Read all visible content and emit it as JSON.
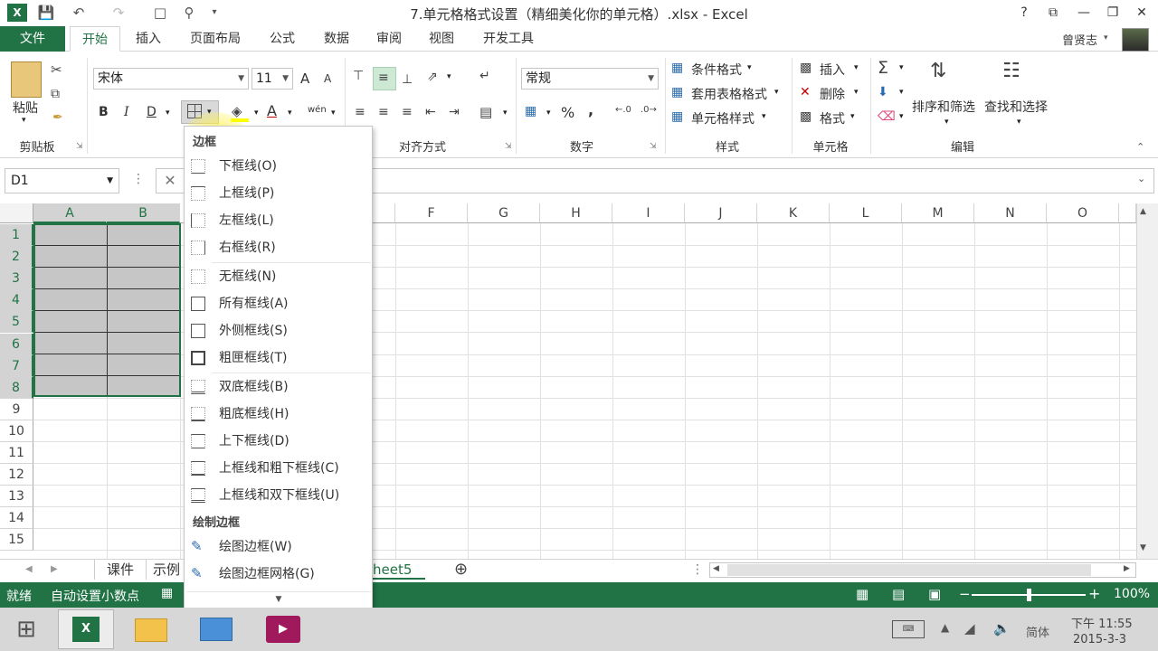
{
  "window": {
    "title": "7.单元格格式设置（精细美化你的单元格）.xlsx - Excel",
    "help": "?",
    "controls": [
      "⧉",
      "—",
      "❐",
      "✕"
    ]
  },
  "ribbon_tabs": {
    "file": "文件",
    "tabs": [
      "开始",
      "插入",
      "页面布局",
      "公式",
      "数据",
      "审阅",
      "视图",
      "开发工具"
    ],
    "active": "开始"
  },
  "user": {
    "name": "曾贤志"
  },
  "clipboard": {
    "paste": "粘贴",
    "group": "剪贴板"
  },
  "font": {
    "name": "宋体",
    "size": "11",
    "bold": "B",
    "italic": "I",
    "underline": "D",
    "grow": "A",
    "shrink": "A",
    "font_color_letter": "A",
    "phonetic": "wén"
  },
  "alignment": {
    "group": "对齐方式"
  },
  "number": {
    "format": "常规",
    "group": "数字",
    "percent": "%",
    "comma": ","
  },
  "styles": {
    "conditional": "条件格式",
    "table": "套用表格格式",
    "cell": "单元格样式",
    "group": "样式"
  },
  "cells": {
    "insert": "插入",
    "delete": "删除",
    "format": "格式",
    "group": "单元格"
  },
  "editing": {
    "sort": "排序和筛选",
    "find": "查找和选择",
    "group": "编辑"
  },
  "formula_bar": {
    "name_box": "D1",
    "value": ""
  },
  "grid": {
    "columns": [
      "A",
      "B",
      "F",
      "G",
      "H",
      "I",
      "J",
      "K",
      "L",
      "M",
      "N",
      "O"
    ],
    "rows": [
      "1",
      "2",
      "3",
      "4",
      "5",
      "6",
      "7",
      "8",
      "9",
      "10",
      "11",
      "12",
      "13",
      "14",
      "15"
    ],
    "selected_range": "A1:B8"
  },
  "borders_menu": {
    "header": "边框",
    "items": [
      {
        "label": "下框线(O)"
      },
      {
        "label": "上框线(P)"
      },
      {
        "label": "左框线(L)"
      },
      {
        "label": "右框线(R)"
      },
      {
        "label": "无框线(N)"
      },
      {
        "label": "所有框线(A)"
      },
      {
        "label": "外侧框线(S)"
      },
      {
        "label": "粗匣框线(T)"
      },
      {
        "label": "双底框线(B)"
      },
      {
        "label": "粗底框线(H)"
      },
      {
        "label": "上下框线(D)"
      },
      {
        "label": "上框线和粗下框线(C)"
      },
      {
        "label": "上框线和双下框线(U)"
      }
    ],
    "draw_header": "绘制边框",
    "draw_items": [
      {
        "label": "绘图边框(W)"
      },
      {
        "label": "绘图边框网格(G)"
      }
    ]
  },
  "sheets": {
    "tabs": [
      "课件",
      "示例"
    ],
    "visible_partial": "heet5",
    "add": "⊕"
  },
  "status": {
    "ready": "就绪",
    "mode": "自动设置小数点",
    "zoom": "100%"
  },
  "taskbar": {
    "ime": "简体",
    "time": "下午 11:55",
    "date": "2015-3-3"
  },
  "colors": {
    "excel_green": "#217346",
    "selection_fill": "#c6c6c6"
  }
}
